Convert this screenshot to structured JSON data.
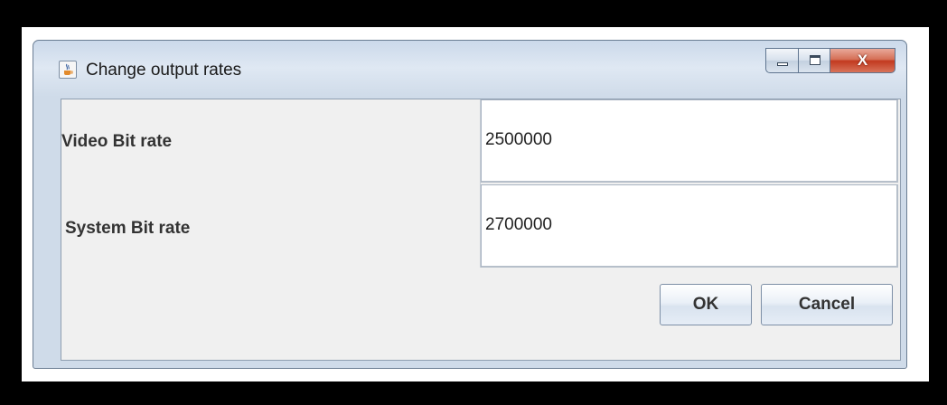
{
  "window": {
    "title": "Change output rates",
    "app_icon": "java-cup-icon",
    "controls": {
      "minimize_icon": "minimize-icon",
      "maximize_icon": "maximize-icon",
      "close_label": "X"
    }
  },
  "form": {
    "rows": [
      {
        "label": "Video Bit rate",
        "value": "2500000"
      },
      {
        "label": "System Bit rate",
        "value": "2700000"
      }
    ]
  },
  "buttons": {
    "ok_label": "OK",
    "cancel_label": "Cancel"
  },
  "colors": {
    "close_button": "#c2391f",
    "panel_background": "#f0f0f0"
  }
}
